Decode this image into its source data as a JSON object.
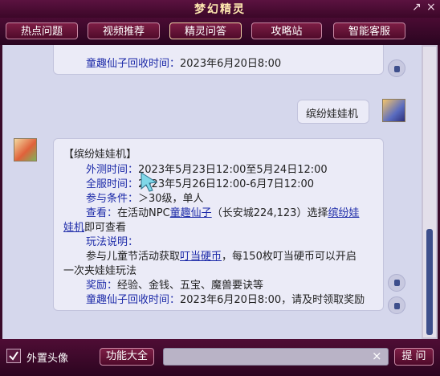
{
  "window": {
    "title": "梦幻精灵",
    "pin_glyph": "↗",
    "close_glyph": "×"
  },
  "tabs": [
    "热点问题",
    "视频推荐",
    "精灵问答",
    "攻略站",
    "智能客服"
  ],
  "top_bubble": {
    "label": "童趣仙子回收时间：",
    "value": "2023年6月20日8:00"
  },
  "user_bubble": {
    "text": "缤纷娃娃机"
  },
  "answer": {
    "heading": "【缤纷娃娃机】",
    "rows": {
      "test_time_label": "外测时间：",
      "test_time": "2023年5月23日12:00至5月24日12:00",
      "full_time_label": "全服时间：",
      "full_time": "2023年5月26日12:00-6月7日12:00",
      "cond_label": "参与条件：",
      "cond": "＞30级，单人",
      "view_label": "查看：",
      "view_pre": "在活动NPC",
      "view_link1": "童趣仙子",
      "view_mid": "（长安城224,123）选择",
      "view_link2a": "缤纷娃",
      "view_link2b": "娃机",
      "view_post": "即可查看",
      "play_label": "玩法说明：",
      "play_pre": "参与儿童节活动获取",
      "play_link": "叮当硬币",
      "play_post": "，每150枚叮当硬币可以开启",
      "play_line2": "一次夹娃娃玩法",
      "reward_label": "奖励：",
      "reward": "经验、金钱、五宝、魔兽要诀等",
      "recycle_label": "童趣仙子回收时间：",
      "recycle": "2023年6月20日8:00，请及时领取奖励"
    }
  },
  "bottom": {
    "checkbox_label": "外置头像",
    "checkbox_checked": true,
    "features_label": "功能大全",
    "input_value": "",
    "clear_glyph": "×",
    "submit_label": "提 问"
  },
  "colors": {
    "accent_link": "#1c2aa8",
    "frame": "#4a0b33"
  }
}
